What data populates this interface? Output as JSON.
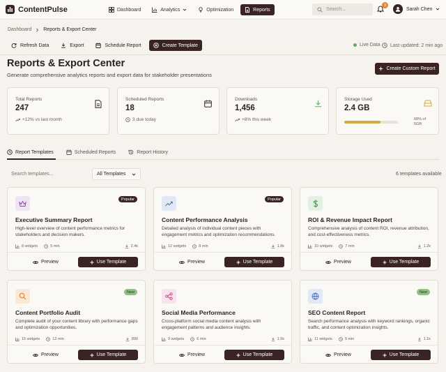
{
  "app": {
    "name": "ContentPulse"
  },
  "nav": {
    "items": [
      {
        "label": "Dashboard",
        "icon": "grid-icon"
      },
      {
        "label": "Analytics",
        "icon": "bar-chart-icon"
      },
      {
        "label": "Optimization",
        "icon": "lightbulb-icon"
      },
      {
        "label": "Reports",
        "icon": "document-icon"
      }
    ],
    "search_placeholder": "Search...",
    "notifications_count": "3",
    "user_name": "Sarah Chen"
  },
  "breadcrumb": {
    "root": "Dashboard",
    "current": "Reports & Export Center"
  },
  "toolbar": {
    "refresh": "Refresh Data",
    "export": "Export",
    "schedule": "Schedule Report",
    "create_template": "Create Template",
    "live": "Live Data",
    "updated": "Last updated: 2 min ago"
  },
  "header": {
    "title": "Reports & Export Center",
    "subtitle": "Generate comprehensive analytics reports and export data for stakeholder presentations",
    "create_custom": "Create Custom Report"
  },
  "stats": {
    "total": {
      "label": "Total Reports",
      "value": "247",
      "note": "+12% vs last month"
    },
    "scheduled": {
      "label": "Scheduled Reports",
      "value": "18",
      "note": "3 due today"
    },
    "downloads": {
      "label": "Downloads",
      "value": "1,456",
      "note": "+8% this week"
    },
    "storage": {
      "label": "Storage Used",
      "value": "2.4 GB",
      "note": "68% of 5GB",
      "percent": 68
    }
  },
  "tabs": {
    "templates": "Report Templates",
    "scheduled": "Scheduled Reports",
    "history": "Report History"
  },
  "filters": {
    "search_placeholder": "Search templates...",
    "select_value": "All Templates",
    "available": "6 templates available"
  },
  "labels": {
    "preview": "Preview",
    "use": "Use Template"
  },
  "colors": {
    "accent": "#3a2423",
    "storage_bar": "#d4a83c",
    "live_dot": "#6aa66a"
  },
  "templates": [
    {
      "title": "Executive Summary Report",
      "desc": "High-level overview of content performance metrics for stakeholders and decision makers.",
      "widgets": "8 widgets",
      "time": "5 min",
      "downloads": "2.4k",
      "badge": "Popular",
      "icon": "crown-icon"
    },
    {
      "title": "Content Performance Analysis",
      "desc": "Detailed analysis of individual content pieces with engagement metrics and optimization recommendations.",
      "widgets": "12 widgets",
      "time": "8 min",
      "downloads": "1.8k",
      "badge": "Popular",
      "icon": "trend-up-icon"
    },
    {
      "title": "ROI & Revenue Impact Report",
      "desc": "Comprehensive analysis of content ROI, revenue attribution, and cost-effectiveness metrics.",
      "widgets": "10 widgets",
      "time": "7 min",
      "downloads": "1.2k",
      "badge": "",
      "icon": "dollar-icon"
    },
    {
      "title": "Content Portfolio Audit",
      "desc": "Complete audit of your content library with performance gaps and optimization opportunities.",
      "widgets": "15 widgets",
      "time": "12 min",
      "downloads": "890",
      "badge": "New",
      "icon": "search-icon"
    },
    {
      "title": "Social Media Performance",
      "desc": "Cross-platform social media content analysis with engagement patterns and audience insights.",
      "widgets": "9 widgets",
      "time": "6 min",
      "downloads": "1.5k",
      "badge": "",
      "icon": "share-icon"
    },
    {
      "title": "SEO Content Report",
      "desc": "Search performance analysis with keyword rankings, organic traffic, and content optimization insights.",
      "widgets": "11 widgets",
      "time": "9 min",
      "downloads": "1.1k",
      "badge": "New",
      "icon": "globe-icon"
    }
  ]
}
